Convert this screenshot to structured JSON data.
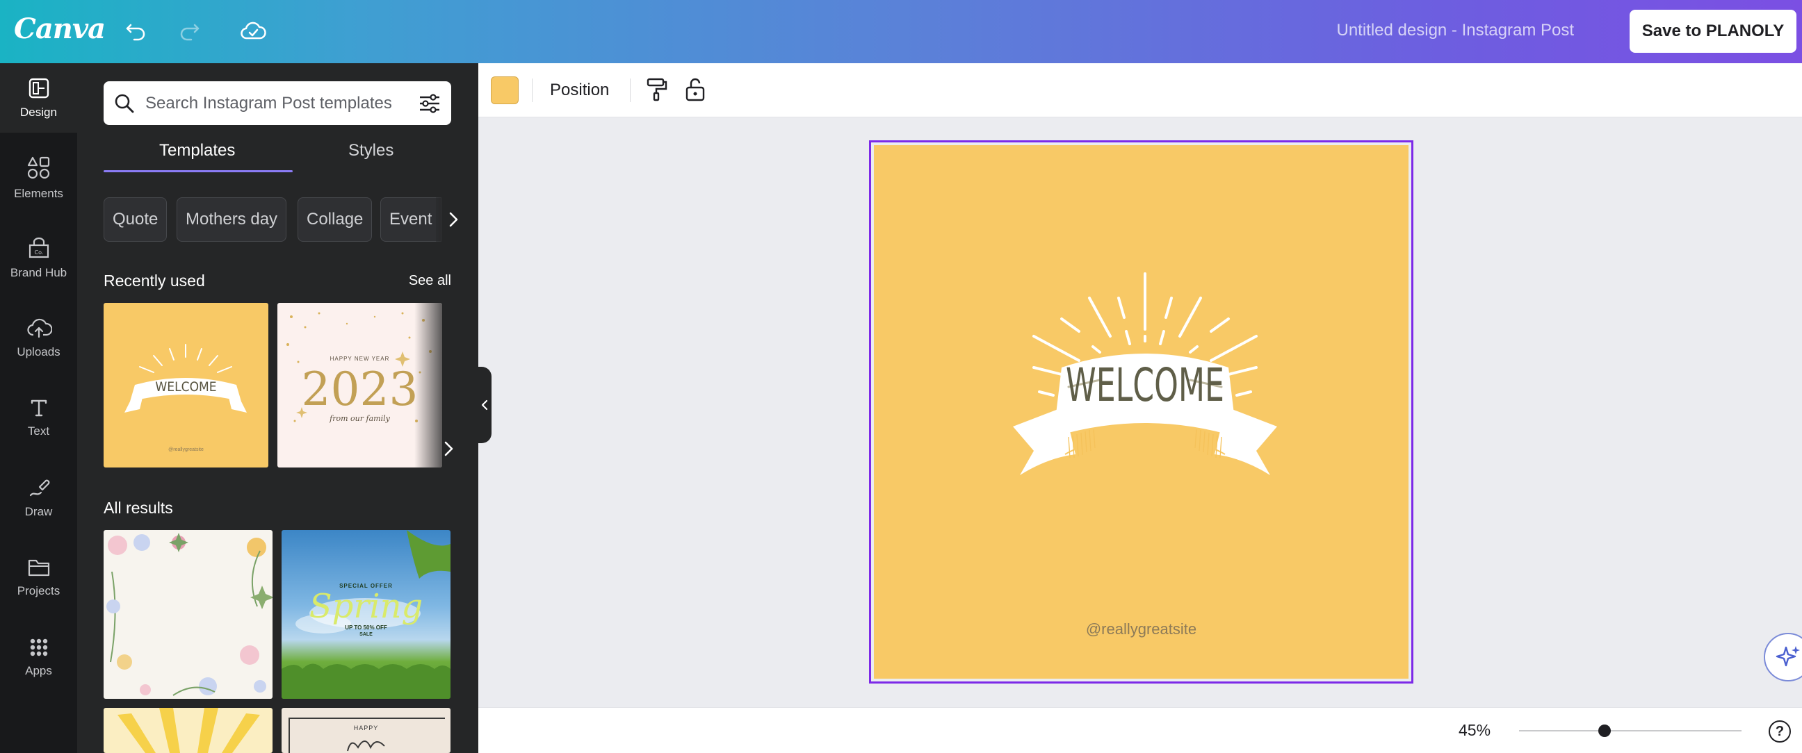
{
  "topbar": {
    "logo": "Canva",
    "doc_title": "Untitled design - Instagram Post",
    "save_label": "Save to PLANOLY",
    "icons": [
      "undo-icon",
      "redo-icon",
      "cloud-saved-icon"
    ]
  },
  "rail": {
    "items": [
      {
        "label": "Design",
        "icon": "design-icon"
      },
      {
        "label": "Elements",
        "icon": "elements-icon"
      },
      {
        "label": "Brand Hub",
        "icon": "brand-hub-icon"
      },
      {
        "label": "Uploads",
        "icon": "uploads-icon"
      },
      {
        "label": "Text",
        "icon": "text-icon"
      },
      {
        "label": "Draw",
        "icon": "draw-icon"
      },
      {
        "label": "Projects",
        "icon": "projects-icon"
      },
      {
        "label": "Apps",
        "icon": "apps-icon"
      }
    ]
  },
  "panel": {
    "search_placeholder": "Search Instagram Post templates",
    "tabs": [
      "Templates",
      "Styles"
    ],
    "chips": [
      "Quote",
      "Mothers day",
      "Collage",
      "Event"
    ],
    "recent_title": "Recently used",
    "see_all": "See all",
    "all_results_title": "All results",
    "recent_thumbs": [
      {
        "welcome": "WELCOME",
        "handle": "@reallygreatsite"
      },
      {
        "small": "HAPPY NEW YEAR",
        "year": "2023",
        "script": "from our family"
      }
    ],
    "results": [
      {
        "kind": "floral"
      },
      {
        "small": "SPECIAL OFFER",
        "big": "Spring",
        "offer": "UP TO 50% OFF",
        "sale": "SALE"
      },
      {
        "kind": "sun"
      },
      {
        "small": "HAPPY"
      }
    ]
  },
  "context_toolbar": {
    "color": "#f8c966",
    "position_label": "Position"
  },
  "canvas": {
    "background": "#f8c966",
    "headline": "WELCOME",
    "handle": "@reallygreatsite"
  },
  "bottombar": {
    "zoom": "45%",
    "zoom_level": 0.45,
    "help": "?"
  }
}
